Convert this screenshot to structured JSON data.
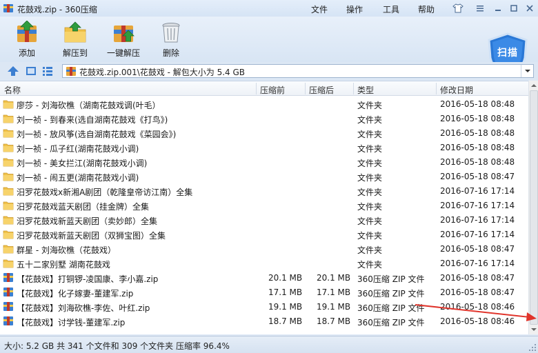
{
  "window": {
    "title": "花鼓戏.zip - 360压缩"
  },
  "menu": {
    "file": "文件",
    "operate": "操作",
    "tools": "工具",
    "help": "帮助"
  },
  "toolbar": {
    "add": "添加",
    "extract_to": "解压到",
    "one_click_extract": "一键解压",
    "delete": "删除",
    "scan": "扫描"
  },
  "address": {
    "path": "花鼓戏.zip.001\\花鼓戏 - 解包大小为 5.4 GB"
  },
  "columns": {
    "name": "名称",
    "compressed": "压缩前",
    "uncompressed": "压缩后",
    "type": "类型",
    "modified": "修改日期"
  },
  "files": [
    {
      "name": "廖莎 - 刘海砍樵（湖南花鼓戏调(叶毛）",
      "size_before": "",
      "size_after": "",
      "type": "文件夹",
      "date": "2016-05-18 08:48",
      "kind": "folder"
    },
    {
      "name": "刘一祯 - 到春来(选自湖南花鼓戏《打鸟》)",
      "size_before": "",
      "size_after": "",
      "type": "文件夹",
      "date": "2016-05-18 08:48",
      "kind": "folder"
    },
    {
      "name": "刘一祯 - 放风筝(选自湖南花鼓戏《菜园会》)",
      "size_before": "",
      "size_after": "",
      "type": "文件夹",
      "date": "2016-05-18 08:48",
      "kind": "folder"
    },
    {
      "name": "刘一祯 - 瓜子红(湖南花鼓戏小调)",
      "size_before": "",
      "size_after": "",
      "type": "文件夹",
      "date": "2016-05-18 08:48",
      "kind": "folder"
    },
    {
      "name": "刘一祯 - 美女拦江(湖南花鼓戏小调)",
      "size_before": "",
      "size_after": "",
      "type": "文件夹",
      "date": "2016-05-18 08:48",
      "kind": "folder"
    },
    {
      "name": "刘一祯 - 闹五更(湖南花鼓戏小调)",
      "size_before": "",
      "size_after": "",
      "type": "文件夹",
      "date": "2016-05-18 08:47",
      "kind": "folder"
    },
    {
      "name": "汨罗花鼓戏x新湘A剧团（乾隆皇帝访江南）全集",
      "size_before": "",
      "size_after": "",
      "type": "文件夹",
      "date": "2016-07-16 17:14",
      "kind": "folder"
    },
    {
      "name": "汨罗花鼓戏蓝天剧团（挂金牌）全集",
      "size_before": "",
      "size_after": "",
      "type": "文件夹",
      "date": "2016-07-16 17:14",
      "kind": "folder"
    },
    {
      "name": "汨罗花鼓戏新蓝天剧团（卖妙郎）全集",
      "size_before": "",
      "size_after": "",
      "type": "文件夹",
      "date": "2016-07-16 17:14",
      "kind": "folder"
    },
    {
      "name": "汨罗花鼓戏新蓝天剧团（双狮宝图）全集",
      "size_before": "",
      "size_after": "",
      "type": "文件夹",
      "date": "2016-07-16 17:14",
      "kind": "folder"
    },
    {
      "name": "群星 - 刘海砍樵（花鼓戏）",
      "size_before": "",
      "size_after": "",
      "type": "文件夹",
      "date": "2016-05-18 08:47",
      "kind": "folder"
    },
    {
      "name": "五十二家别墅 湖南花鼓戏",
      "size_before": "",
      "size_after": "",
      "type": "文件夹",
      "date": "2016-07-16 17:14",
      "kind": "folder"
    },
    {
      "name": "【花鼓戏】打铜锣-凌国康、李小嘉.zip",
      "size_before": "20.1 MB",
      "size_after": "20.1 MB",
      "type": "360压缩 ZIP 文件",
      "date": "2016-05-18 08:47",
      "kind": "zip"
    },
    {
      "name": "【花鼓戏】化子嫁妻-董建军.zip",
      "size_before": "17.1 MB",
      "size_after": "17.1 MB",
      "type": "360压缩 ZIP 文件",
      "date": "2016-05-18 08:47",
      "kind": "zip"
    },
    {
      "name": "【花鼓戏】刘海砍樵-李佐、叶红.zip",
      "size_before": "19.1 MB",
      "size_after": "19.1 MB",
      "type": "360压缩 ZIP 文件",
      "date": "2016-05-18 08:46",
      "kind": "zip"
    },
    {
      "name": "【花鼓戏】讨学钱-董建军.zip",
      "size_before": "18.7 MB",
      "size_after": "18.7 MB",
      "type": "360压缩 ZIP 文件",
      "date": "2016-05-18 08:46",
      "kind": "zip"
    }
  ],
  "status": {
    "text": "大小: 5.2 GB 共 341 个文件和 309 个文件夹 压缩率 96.4%"
  },
  "colors": {
    "accent": "#1f6fcb",
    "folder": "#f0c24a",
    "arrow": "#e0342b"
  }
}
